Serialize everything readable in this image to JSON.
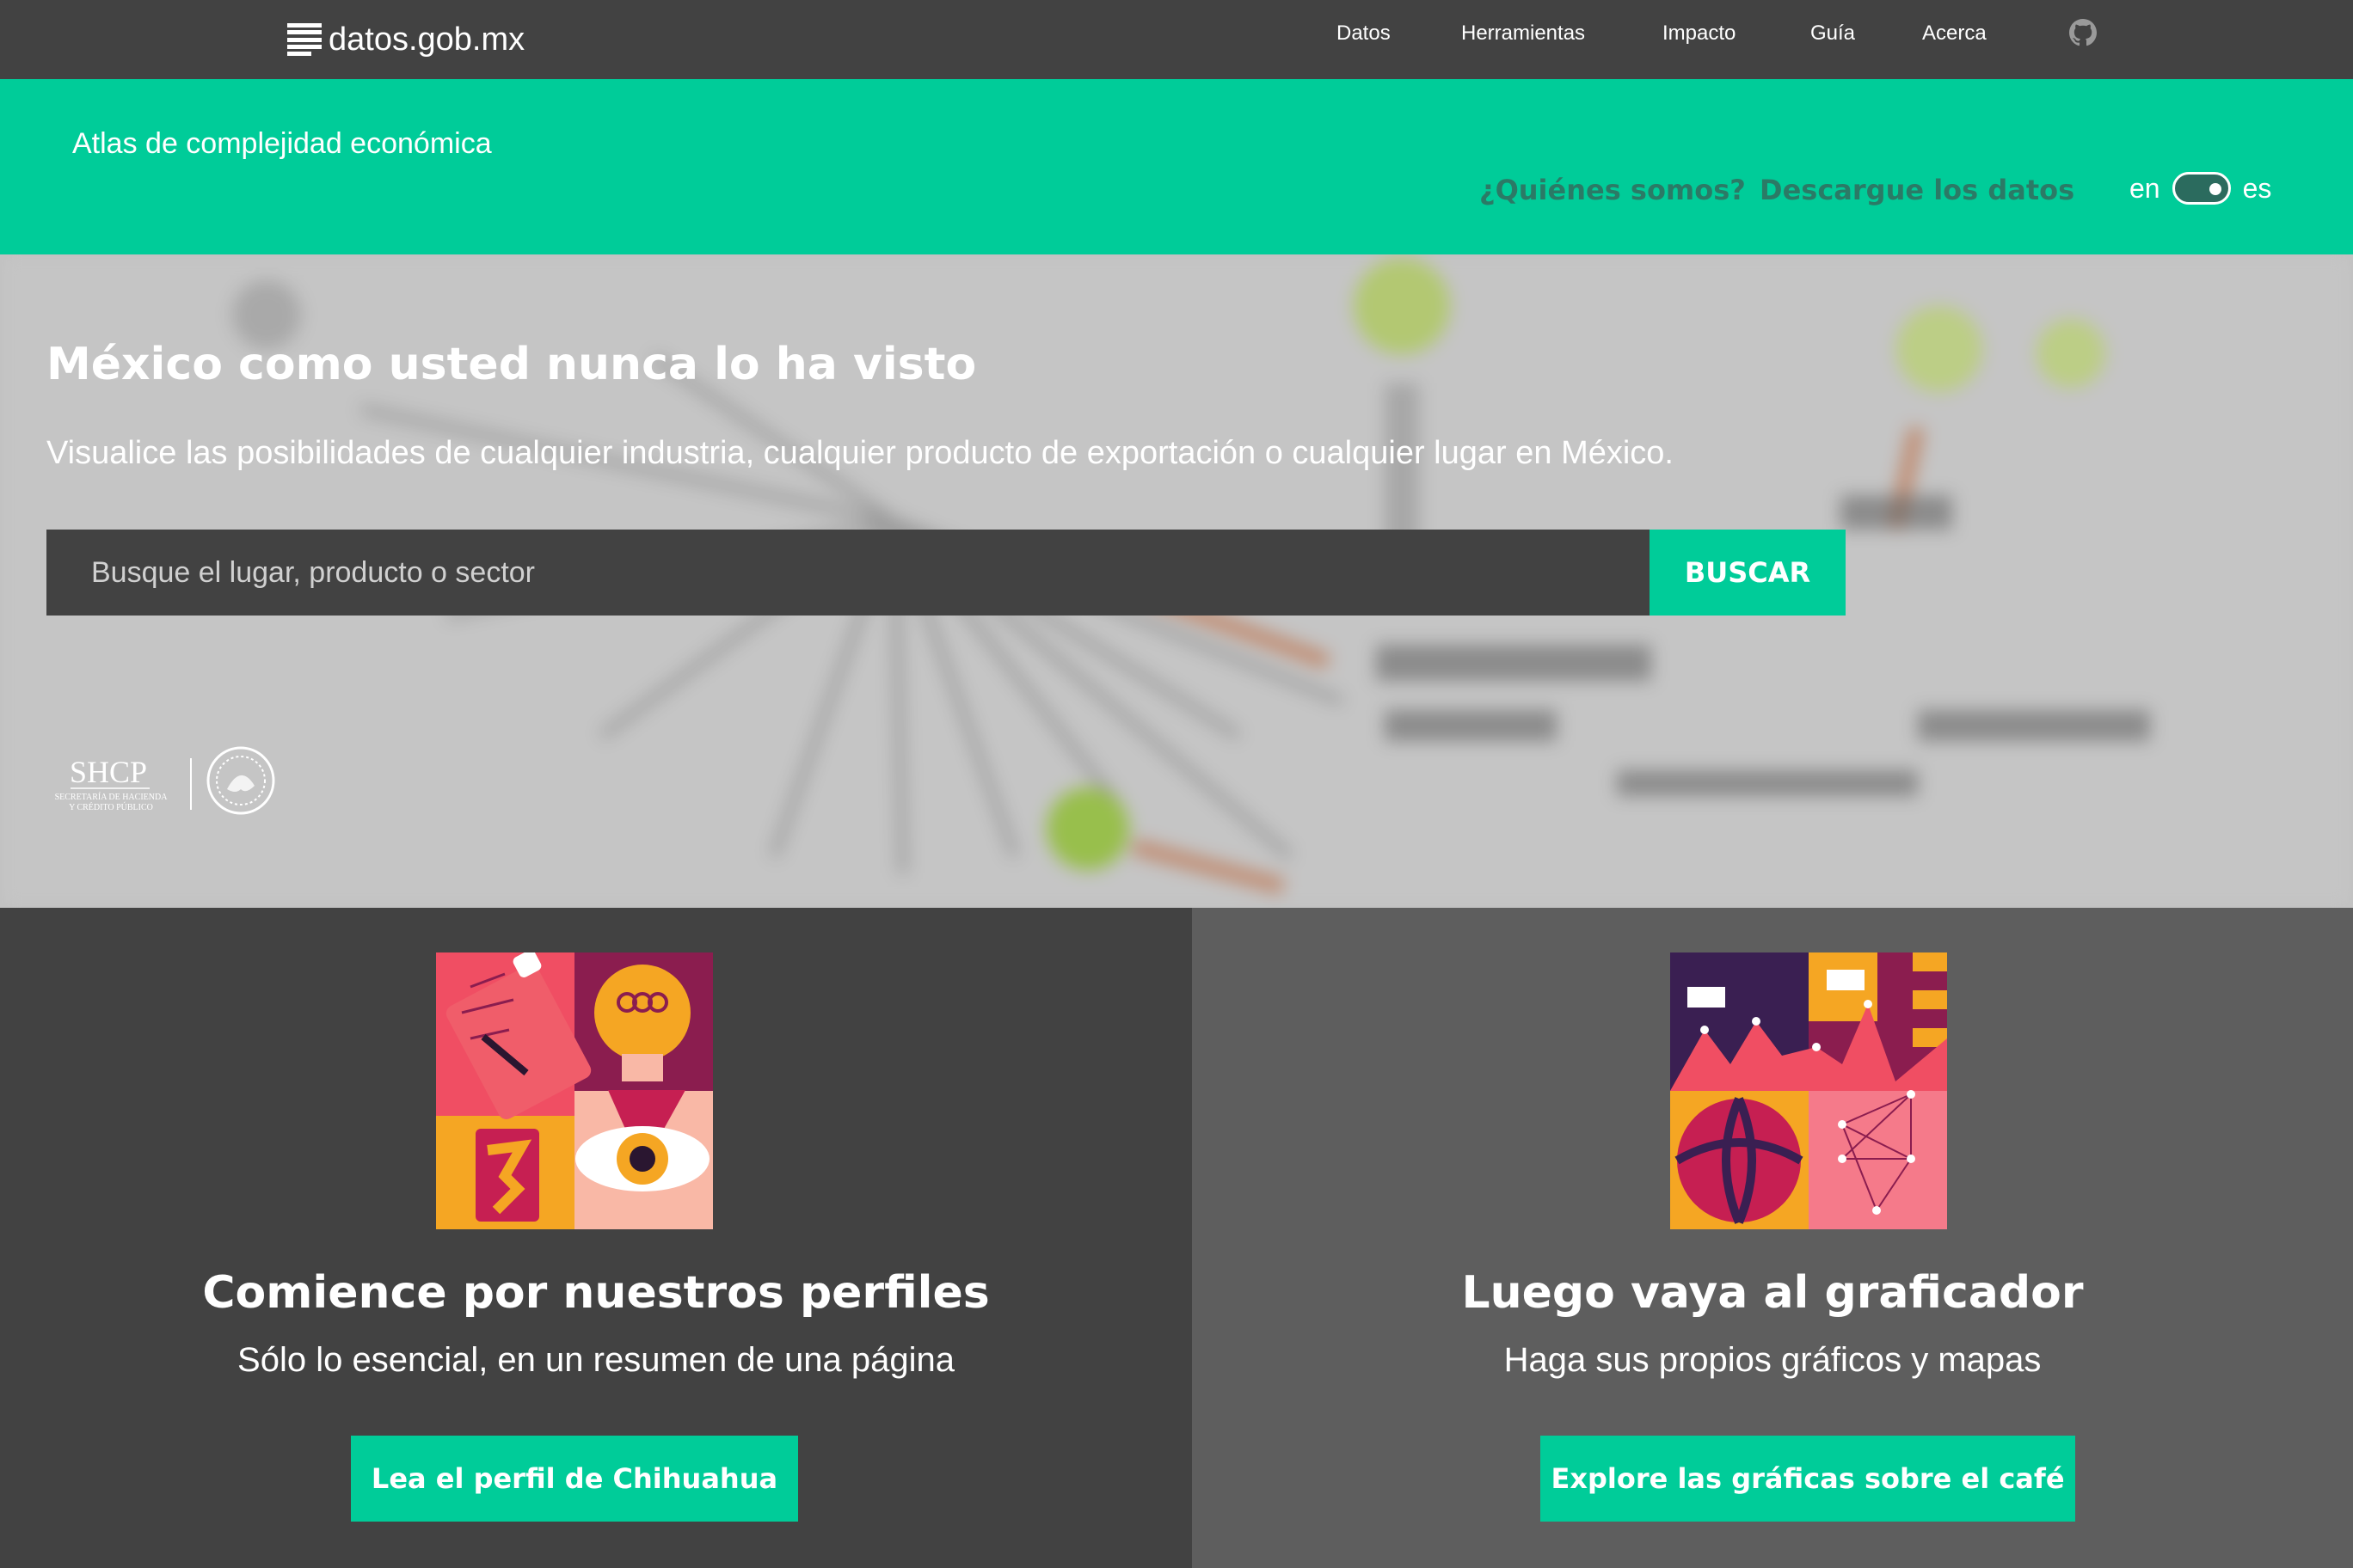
{
  "topbar": {
    "logo_text": "datos.gob.mx",
    "nav": [
      "Datos",
      "Herramientas",
      "Impacto",
      "Guía",
      "Acerca"
    ],
    "github_icon": "github-icon"
  },
  "band": {
    "title": "Atlas de complejidad económica",
    "links": [
      "¿Quiénes somos?",
      "Descargue los datos"
    ],
    "lang_left": "en",
    "lang_right": "es",
    "accent_color": "#00cc99"
  },
  "hero": {
    "title": "México como usted nunca lo ha visto",
    "subtitle": "Visualice las posibilidades de cualquier industria, cualquier producto de exportación o cualquier lugar en México.",
    "search_placeholder": "Busque el lugar, producto o sector",
    "search_button": "BUSCAR",
    "logo_shcp": "SHCP",
    "logo_shcp_sub1": "SECRETARÍA DE HACIENDA",
    "logo_shcp_sub2": "Y CRÉDITO PÚBLICO"
  },
  "cards": [
    {
      "title": "Comience por nuestros perfiles",
      "subtitle": "Sólo lo esencial, en un resumen de una página",
      "button": "Lea el perfil de Chihuahua"
    },
    {
      "title": "Luego vaya al graficador",
      "subtitle": "Haga sus propios gráficos y mapas",
      "button": "Explore las gráficas sobre el café"
    }
  ]
}
